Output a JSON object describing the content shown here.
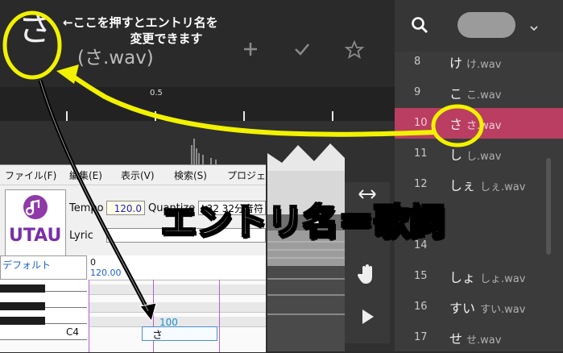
{
  "editor": {
    "entry_char": "さ",
    "file_label": "(さ.wav)",
    "annotation": "←ここを押すとエントリ名を\n                変更できます",
    "ruler_label": "0.5"
  },
  "utau": {
    "menu": [
      "ファイル(F)",
      "編集(E)",
      "表示(V)",
      "検索(S)",
      "プロジェ"
    ],
    "logo_text": "UTAU",
    "tempo_label": "Tempo",
    "tempo_value": "120.0",
    "quantize_label": "Quantize",
    "quantize_value": "L32 32分音符",
    "lyric_label": "Lyric",
    "track_name": "デフォルト",
    "track_pos": "0",
    "track_tempo": "120.00",
    "key_label": "C4",
    "note_velocity": "100",
    "note_lyric": "さ"
  },
  "sidebar": {
    "rows": [
      {
        "num": "8",
        "entry": "け",
        "file": "け.wav",
        "selected": false
      },
      {
        "num": "9",
        "entry": "こ",
        "file": "こ.wav",
        "selected": false
      },
      {
        "num": "10",
        "entry": "さ",
        "file": "さ.wav",
        "selected": true
      },
      {
        "num": "11",
        "entry": "し",
        "file": "し.wav",
        "selected": false
      },
      {
        "num": "12",
        "entry": "しぇ",
        "file": "しぇ.wav",
        "selected": false
      },
      {
        "num": "13",
        "entry": "",
        "file": "",
        "selected": false
      },
      {
        "num": "14",
        "entry": "",
        "file": "",
        "selected": false
      },
      {
        "num": "15",
        "entry": "しょ",
        "file": "しょ.wav",
        "selected": false
      },
      {
        "num": "16",
        "entry": "すい",
        "file": "すい.wav",
        "selected": false
      },
      {
        "num": "17",
        "entry": "せ",
        "file": "せ.wav",
        "selected": false
      }
    ]
  },
  "overlay": {
    "caption": "エントリ名＝歌詞"
  },
  "colors": {
    "accent": "#b93e62",
    "highlight_yellow": "#f2f200",
    "utau_purple": "#7b2fa6"
  },
  "icons": [
    "search-icon",
    "chevron-down-icon",
    "add-icon",
    "check-icon",
    "star-icon",
    "resize-icon",
    "hand-icon",
    "play-icon"
  ]
}
